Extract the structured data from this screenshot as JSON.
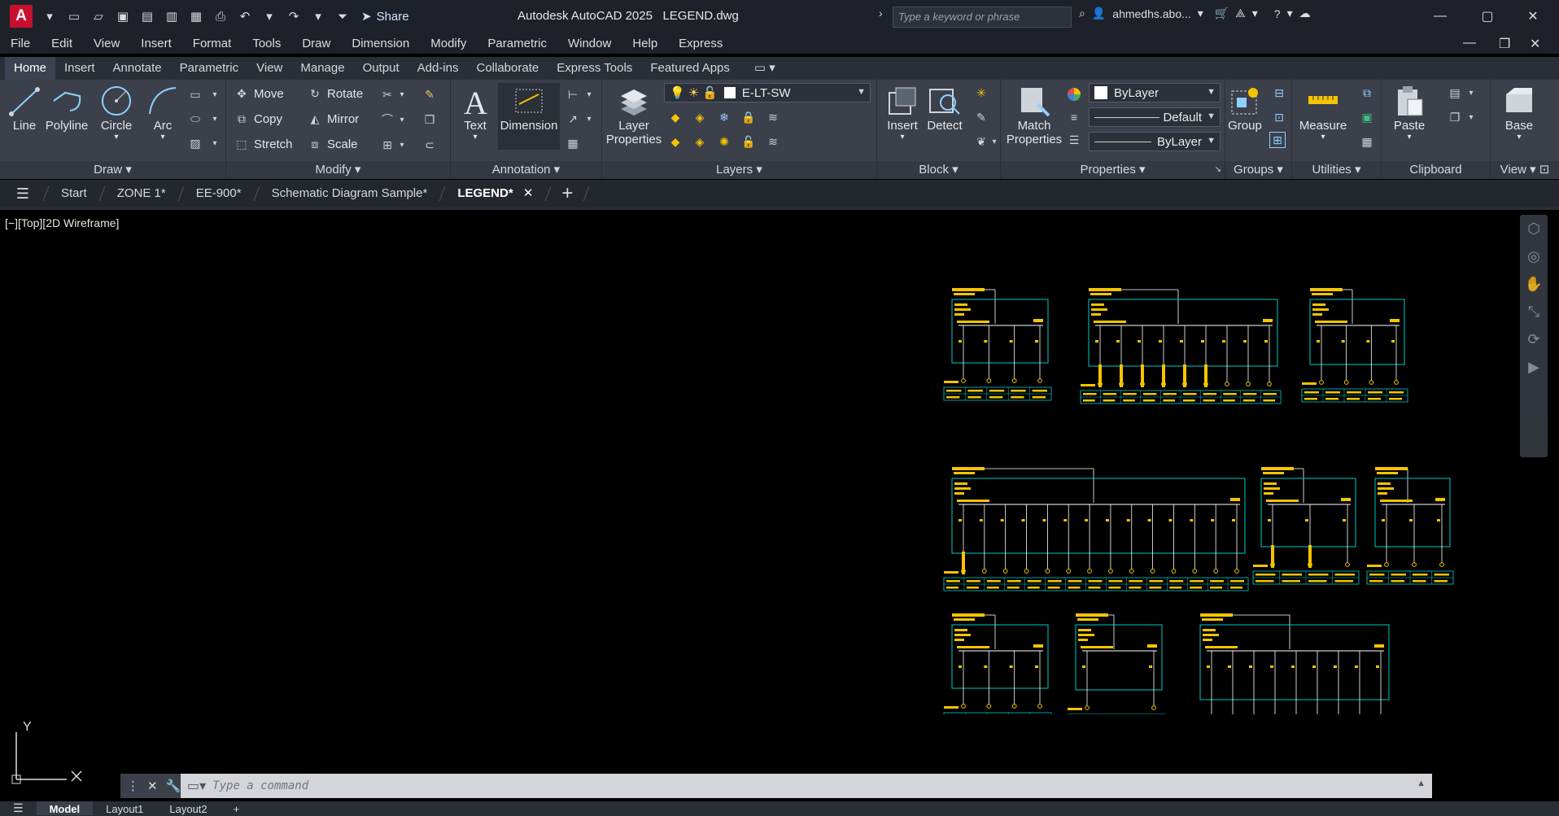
{
  "app": {
    "logo": "A",
    "title": "Autodesk AutoCAD 2025",
    "filename": "LEGEND.dwg",
    "share_label": "Share",
    "search_placeholder": "Type a keyword or phrase",
    "user": "ahmedhs.abo..."
  },
  "menu": [
    "File",
    "Edit",
    "View",
    "Insert",
    "Format",
    "Tools",
    "Draw",
    "Dimension",
    "Modify",
    "Parametric",
    "Window",
    "Help",
    "Express"
  ],
  "ribbon_tabs": [
    "Home",
    "Insert",
    "Annotate",
    "Parametric",
    "View",
    "Manage",
    "Output",
    "Add-ins",
    "Collaborate",
    "Express Tools",
    "Featured Apps"
  ],
  "ribbon": {
    "draw": {
      "title": "Draw",
      "line": "Line",
      "polyline": "Polyline",
      "circle": "Circle",
      "arc": "Arc"
    },
    "modify": {
      "title": "Modify",
      "move": "Move",
      "rotate": "Rotate",
      "copy": "Copy",
      "mirror": "Mirror",
      "stretch": "Stretch",
      "scale": "Scale"
    },
    "annotation": {
      "title": "Annotation",
      "text": "Text",
      "dimension": "Dimension"
    },
    "layers": {
      "title": "Layers",
      "layer_properties_1": "Layer",
      "layer_properties_2": "Properties",
      "current_layer": "E-LT-SW"
    },
    "block": {
      "title": "Block",
      "insert": "Insert",
      "detect": "Detect"
    },
    "properties": {
      "title": "Properties",
      "match_1": "Match",
      "match_2": "Properties",
      "color": "ByLayer",
      "lineweight": "Default",
      "linetype": "ByLayer"
    },
    "groups": {
      "title": "Groups",
      "group": "Group"
    },
    "utilities": {
      "title": "Utilities",
      "measure": "Measure"
    },
    "clipboard": {
      "title": "Clipboard",
      "paste": "Paste"
    },
    "view": {
      "title": "View",
      "base": "Base"
    }
  },
  "file_tabs": [
    "Start",
    "ZONE 1*",
    "EE-900*",
    "Schematic Diagram Sample*",
    "LEGEND*"
  ],
  "viewport": {
    "label": "[−][Top][2D Wireframe]",
    "ucs_y": "Y"
  },
  "command": {
    "placeholder": "Type a command"
  },
  "status": {
    "model": "Model",
    "layout1": "Layout1",
    "layout2": "Layout2"
  },
  "colors": {
    "accent_cyan": "#00c8c8",
    "accent_yellow": "#f5c400",
    "drawing_white": "#ffffff",
    "brand_red": "#c8102e"
  }
}
